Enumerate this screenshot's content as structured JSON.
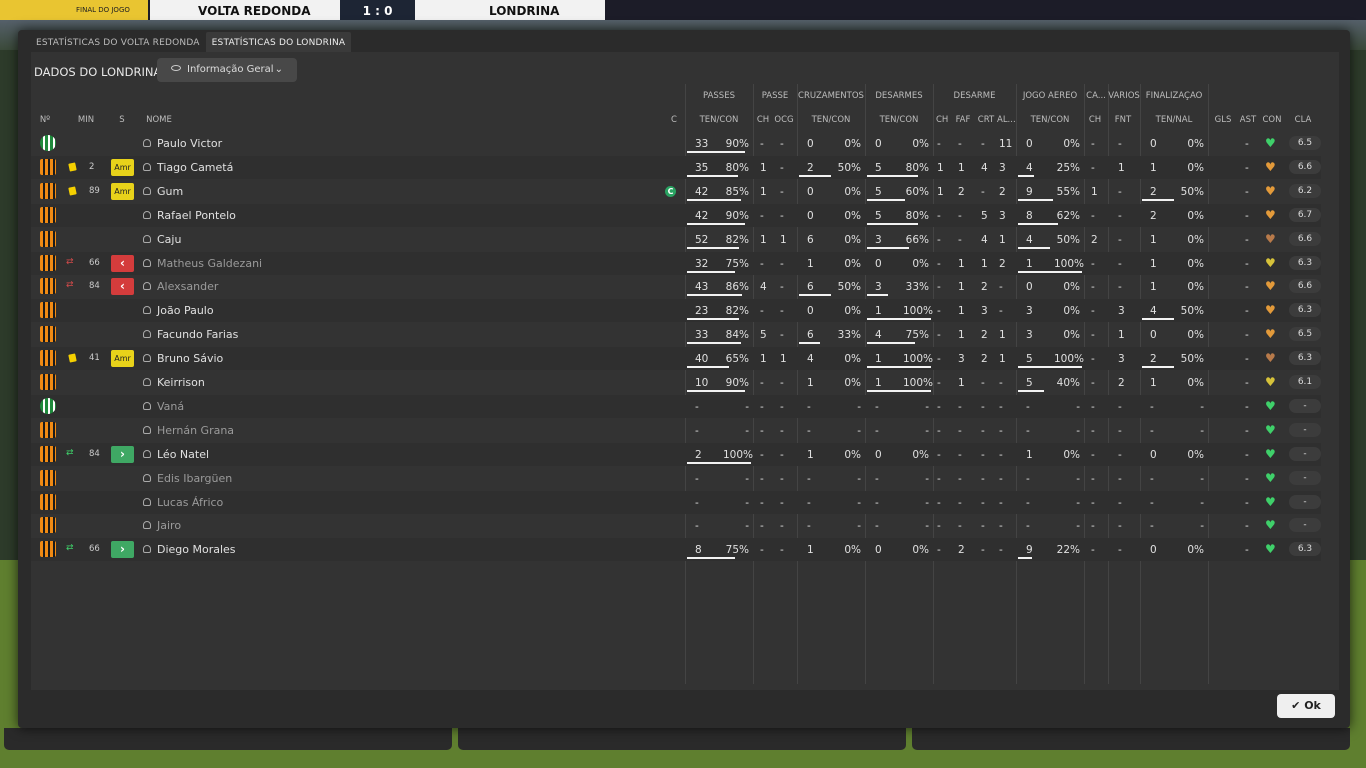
{
  "scoreboard": {
    "status": "FINAL DO JOGO",
    "home": "VOLTA REDONDA",
    "score": "1 : 0",
    "away": "LONDRINA"
  },
  "tabs": [
    "ESTATÍSTICAS DO VOLTA REDONDA",
    "ESTATÍSTICAS DO LONDRINA"
  ],
  "header": {
    "title": "DADOS DO LONDRINA",
    "view": "Informação Geral"
  },
  "colors": {
    "accent": "#3fd06a",
    "card": "#f5d000",
    "sub_out": "#d43c3c",
    "sub_in": "#3fa864"
  },
  "groups": [
    "PASSES",
    "PASSE",
    "CRUZAMENTOS",
    "DESARMES",
    "DESARME",
    "JOGO AÉREO",
    "CA...",
    "VÁRIOS",
    "FINALIZAÇÃO"
  ],
  "subheads": {
    "no": "Nº",
    "min": "MIN",
    "s": "S",
    "name": "NOME",
    "c": "C",
    "pas": "TEN/CON",
    "pch": "CH",
    "pocg": "OCG",
    "cru": "TEN/CON",
    "des": "TEN/CON",
    "dch": "CH",
    "dfaf": "FAF",
    "dcrt": "CRT",
    "dal": "AL...",
    "jog": "TEN/CON",
    "cach": "CH",
    "vfnt": "FNT",
    "fin": "TEN/NAL",
    "gls": "GLS",
    "ast": "AST",
    "con": "CON",
    "cla": "CLA"
  },
  "players": [
    {
      "kit": "gr",
      "card": "",
      "min": "",
      "badge": "",
      "name": "Paulo Victor",
      "cap": false,
      "dim": false,
      "pt": "33",
      "pc": "90%",
      "pb": 0.9,
      "pch": "-",
      "ocg": "-",
      "ct": "0",
      "cp": "0%",
      "cb": 0,
      "dt": "0",
      "dp": "0%",
      "db": 0,
      "dch": "-",
      "faf": "-",
      "crt": "-",
      "al": "11",
      "jt": "0",
      "jp": "0%",
      "jb": 0,
      "ca": "-",
      "fnt": "-",
      "ft": "0",
      "fp": "0%",
      "fb": 0,
      "gls": "-",
      "ast": "",
      "heart": "#3fd06a",
      "cla": "6.5"
    },
    {
      "kit": "or",
      "card": "y",
      "min": "2",
      "badge": "amr",
      "name": "Tiago Cametá",
      "cap": false,
      "dim": false,
      "pt": "35",
      "pc": "80%",
      "pb": 0.8,
      "pch": "1",
      "ocg": "-",
      "ct": "2",
      "cp": "50%",
      "cb": 0.5,
      "dt": "5",
      "dp": "80%",
      "db": 0.8,
      "dch": "1",
      "faf": "1",
      "crt": "4",
      "al": "3",
      "jt": "4",
      "jp": "25%",
      "jb": 0.25,
      "ca": "-",
      "fnt": "1",
      "ft": "1",
      "fp": "0%",
      "fb": 0,
      "gls": "-",
      "ast": "",
      "heart": "#e39a3a",
      "cla": "6.6"
    },
    {
      "kit": "or",
      "card": "y",
      "min": "89",
      "badge": "amr",
      "name": "Gum",
      "cap": true,
      "dim": false,
      "pt": "42",
      "pc": "85%",
      "pb": 0.85,
      "pch": "1",
      "ocg": "-",
      "ct": "0",
      "cp": "0%",
      "cb": 0,
      "dt": "5",
      "dp": "60%",
      "db": 0.6,
      "dch": "1",
      "faf": "2",
      "crt": "-",
      "al": "2",
      "jt": "9",
      "jp": "55%",
      "jb": 0.55,
      "ca": "1",
      "fnt": "-",
      "ft": "2",
      "fp": "50%",
      "fb": 0.5,
      "gls": "-",
      "ast": "",
      "heart": "#e39a3a",
      "cla": "6.2"
    },
    {
      "kit": "or",
      "card": "",
      "min": "",
      "badge": "",
      "name": "Rafael Pontelo",
      "cap": false,
      "dim": false,
      "pt": "42",
      "pc": "90%",
      "pb": 0.9,
      "pch": "-",
      "ocg": "-",
      "ct": "0",
      "cp": "0%",
      "cb": 0,
      "dt": "5",
      "dp": "80%",
      "db": 0.8,
      "dch": "-",
      "faf": "-",
      "crt": "5",
      "al": "3",
      "jt": "8",
      "jp": "62%",
      "jb": 0.62,
      "ca": "-",
      "fnt": "-",
      "ft": "2",
      "fp": "0%",
      "fb": 0,
      "gls": "-",
      "ast": "",
      "heart": "#e39a3a",
      "cla": "6.7"
    },
    {
      "kit": "or",
      "card": "",
      "min": "",
      "badge": "",
      "name": "Caju",
      "cap": false,
      "dim": false,
      "pt": "52",
      "pc": "82%",
      "pb": 0.82,
      "pch": "1",
      "ocg": "1",
      "ct": "6",
      "cp": "0%",
      "cb": 0,
      "dt": "3",
      "dp": "66%",
      "db": 0.66,
      "dch": "-",
      "faf": "-",
      "crt": "4",
      "al": "1",
      "jt": "4",
      "jp": "50%",
      "jb": 0.5,
      "ca": "2",
      "fnt": "-",
      "ft": "1",
      "fp": "0%",
      "fb": 0,
      "gls": "-",
      "ast": "",
      "heart": "#b87a4a",
      "cla": "6.6"
    },
    {
      "kit": "or",
      "card": "",
      "min": "66",
      "badge": "red",
      "name": "Matheus Galdezani",
      "cap": false,
      "dim": true,
      "pt": "32",
      "pc": "75%",
      "pb": 0.75,
      "pch": "-",
      "ocg": "-",
      "ct": "1",
      "cp": "0%",
      "cb": 0,
      "dt": "0",
      "dp": "0%",
      "db": 0,
      "dch": "-",
      "faf": "1",
      "crt": "1",
      "al": "2",
      "jt": "1",
      "jp": "100%",
      "jb": 1,
      "ca": "-",
      "fnt": "-",
      "ft": "1",
      "fp": "0%",
      "fb": 0,
      "gls": "-",
      "ast": "",
      "heart": "#d6c23a",
      "cla": "6.3"
    },
    {
      "kit": "or",
      "card": "",
      "min": "84",
      "badge": "red",
      "name": "Alexsander",
      "cap": false,
      "dim": true,
      "pt": "43",
      "pc": "86%",
      "pb": 0.86,
      "pch": "4",
      "ocg": "-",
      "ct": "6",
      "cp": "50%",
      "cb": 0.5,
      "dt": "3",
      "dp": "33%",
      "db": 0.33,
      "dch": "-",
      "faf": "1",
      "crt": "2",
      "al": "-",
      "jt": "0",
      "jp": "0%",
      "jb": 0,
      "ca": "-",
      "fnt": "-",
      "ft": "1",
      "fp": "0%",
      "fb": 0,
      "gls": "-",
      "ast": "",
      "heart": "#e39a3a",
      "cla": "6.6"
    },
    {
      "kit": "or",
      "card": "",
      "min": "",
      "badge": "",
      "name": "João Paulo",
      "cap": false,
      "dim": false,
      "pt": "23",
      "pc": "82%",
      "pb": 0.82,
      "pch": "-",
      "ocg": "-",
      "ct": "0",
      "cp": "0%",
      "cb": 0,
      "dt": "1",
      "dp": "100%",
      "db": 1,
      "dch": "-",
      "faf": "1",
      "crt": "3",
      "al": "-",
      "jt": "3",
      "jp": "0%",
      "jb": 0,
      "ca": "-",
      "fnt": "3",
      "ft": "4",
      "fp": "50%",
      "fb": 0.5,
      "gls": "-",
      "ast": "",
      "heart": "#e39a3a",
      "cla": "6.3"
    },
    {
      "kit": "or",
      "card": "",
      "min": "",
      "badge": "",
      "name": "Facundo Farias",
      "cap": false,
      "dim": false,
      "pt": "33",
      "pc": "84%",
      "pb": 0.84,
      "pch": "5",
      "ocg": "-",
      "ct": "6",
      "cp": "33%",
      "cb": 0.33,
      "dt": "4",
      "dp": "75%",
      "db": 0.75,
      "dch": "-",
      "faf": "1",
      "crt": "2",
      "al": "1",
      "jt": "3",
      "jp": "0%",
      "jb": 0,
      "ca": "-",
      "fnt": "1",
      "ft": "0",
      "fp": "0%",
      "fb": 0,
      "gls": "-",
      "ast": "",
      "heart": "#e39a3a",
      "cla": "6.5"
    },
    {
      "kit": "or",
      "card": "y",
      "min": "41",
      "badge": "amr",
      "name": "Bruno Sávio",
      "cap": false,
      "dim": false,
      "pt": "40",
      "pc": "65%",
      "pb": 0.65,
      "pch": "1",
      "ocg": "1",
      "ct": "4",
      "cp": "0%",
      "cb": 0,
      "dt": "1",
      "dp": "100%",
      "db": 1,
      "dch": "-",
      "faf": "3",
      "crt": "2",
      "al": "1",
      "jt": "5",
      "jp": "100%",
      "jb": 1,
      "ca": "-",
      "fnt": "3",
      "ft": "2",
      "fp": "50%",
      "fb": 0.5,
      "gls": "-",
      "ast": "",
      "heart": "#b87a4a",
      "cla": "6.3"
    },
    {
      "kit": "or",
      "card": "",
      "min": "",
      "badge": "",
      "name": "Keirrison",
      "cap": false,
      "dim": false,
      "pt": "10",
      "pc": "90%",
      "pb": 0.9,
      "pch": "-",
      "ocg": "-",
      "ct": "1",
      "cp": "0%",
      "cb": 0,
      "dt": "1",
      "dp": "100%",
      "db": 1,
      "dch": "-",
      "faf": "1",
      "crt": "-",
      "al": "-",
      "jt": "5",
      "jp": "40%",
      "jb": 0.4,
      "ca": "-",
      "fnt": "2",
      "ft": "1",
      "fp": "0%",
      "fb": 0,
      "gls": "-",
      "ast": "",
      "heart": "#d6c23a",
      "cla": "6.1"
    },
    {
      "kit": "gr",
      "card": "",
      "min": "",
      "badge": "",
      "name": "Vaná",
      "cap": false,
      "dim": true,
      "pt": "-",
      "pc": "-",
      "pb": 0,
      "pch": "-",
      "ocg": "-",
      "ct": "-",
      "cp": "-",
      "cb": 0,
      "dt": "-",
      "dp": "-",
      "db": 0,
      "dch": "-",
      "faf": "-",
      "crt": "-",
      "al": "-",
      "jt": "-",
      "jp": "-",
      "jb": 0,
      "ca": "-",
      "fnt": "-",
      "ft": "-",
      "fp": "-",
      "fb": 0,
      "gls": "-",
      "ast": "",
      "heart": "#3fd06a",
      "cla": "-"
    },
    {
      "kit": "or",
      "card": "",
      "min": "",
      "badge": "",
      "name": "Hernán Grana",
      "cap": false,
      "dim": true,
      "pt": "-",
      "pc": "-",
      "pb": 0,
      "pch": "-",
      "ocg": "-",
      "ct": "-",
      "cp": "-",
      "cb": 0,
      "dt": "-",
      "dp": "-",
      "db": 0,
      "dch": "-",
      "faf": "-",
      "crt": "-",
      "al": "-",
      "jt": "-",
      "jp": "-",
      "jb": 0,
      "ca": "-",
      "fnt": "-",
      "ft": "-",
      "fp": "-",
      "fb": 0,
      "gls": "-",
      "ast": "",
      "heart": "#3fd06a",
      "cla": "-"
    },
    {
      "kit": "or",
      "card": "",
      "min": "84",
      "badge": "grn",
      "name": "Léo Natel",
      "cap": false,
      "dim": false,
      "pt": "2",
      "pc": "100%",
      "pb": 1,
      "pch": "-",
      "ocg": "-",
      "ct": "1",
      "cp": "0%",
      "cb": 0,
      "dt": "0",
      "dp": "0%",
      "db": 0,
      "dch": "-",
      "faf": "-",
      "crt": "-",
      "al": "-",
      "jt": "1",
      "jp": "0%",
      "jb": 0,
      "ca": "-",
      "fnt": "-",
      "ft": "0",
      "fp": "0%",
      "fb": 0,
      "gls": "-",
      "ast": "",
      "heart": "#3fd06a",
      "cla": "-"
    },
    {
      "kit": "or",
      "card": "",
      "min": "",
      "badge": "",
      "name": "Edis Ibargüen",
      "cap": false,
      "dim": true,
      "pt": "-",
      "pc": "-",
      "pb": 0,
      "pch": "-",
      "ocg": "-",
      "ct": "-",
      "cp": "-",
      "cb": 0,
      "dt": "-",
      "dp": "-",
      "db": 0,
      "dch": "-",
      "faf": "-",
      "crt": "-",
      "al": "-",
      "jt": "-",
      "jp": "-",
      "jb": 0,
      "ca": "-",
      "fnt": "-",
      "ft": "-",
      "fp": "-",
      "fb": 0,
      "gls": "-",
      "ast": "",
      "heart": "#3fd06a",
      "cla": "-"
    },
    {
      "kit": "or",
      "card": "",
      "min": "",
      "badge": "",
      "name": "Lucas Áfrico",
      "cap": false,
      "dim": true,
      "pt": "-",
      "pc": "-",
      "pb": 0,
      "pch": "-",
      "ocg": "-",
      "ct": "-",
      "cp": "-",
      "cb": 0,
      "dt": "-",
      "dp": "-",
      "db": 0,
      "dch": "-",
      "faf": "-",
      "crt": "-",
      "al": "-",
      "jt": "-",
      "jp": "-",
      "jb": 0,
      "ca": "-",
      "fnt": "-",
      "ft": "-",
      "fp": "-",
      "fb": 0,
      "gls": "-",
      "ast": "",
      "heart": "#3fd06a",
      "cla": "-"
    },
    {
      "kit": "or",
      "card": "",
      "min": "",
      "badge": "",
      "name": "Jairo",
      "cap": false,
      "dim": true,
      "pt": "-",
      "pc": "-",
      "pb": 0,
      "pch": "-",
      "ocg": "-",
      "ct": "-",
      "cp": "-",
      "cb": 0,
      "dt": "-",
      "dp": "-",
      "db": 0,
      "dch": "-",
      "faf": "-",
      "crt": "-",
      "al": "-",
      "jt": "-",
      "jp": "-",
      "jb": 0,
      "ca": "-",
      "fnt": "-",
      "ft": "-",
      "fp": "-",
      "fb": 0,
      "gls": "-",
      "ast": "",
      "heart": "#3fd06a",
      "cla": "-"
    },
    {
      "kit": "or",
      "card": "",
      "min": "66",
      "badge": "grn",
      "name": "Diego Morales",
      "cap": false,
      "dim": false,
      "pt": "8",
      "pc": "75%",
      "pb": 0.75,
      "pch": "-",
      "ocg": "-",
      "ct": "1",
      "cp": "0%",
      "cb": 0,
      "dt": "0",
      "dp": "0%",
      "db": 0,
      "dch": "-",
      "faf": "2",
      "crt": "-",
      "al": "-",
      "jt": "9",
      "jp": "22%",
      "jb": 0.22,
      "ca": "-",
      "fnt": "-",
      "ft": "0",
      "fp": "0%",
      "fb": 0,
      "gls": "-",
      "ast": "",
      "heart": "#3fd06a",
      "cla": "6.3"
    }
  ],
  "ok_label": "Ok"
}
